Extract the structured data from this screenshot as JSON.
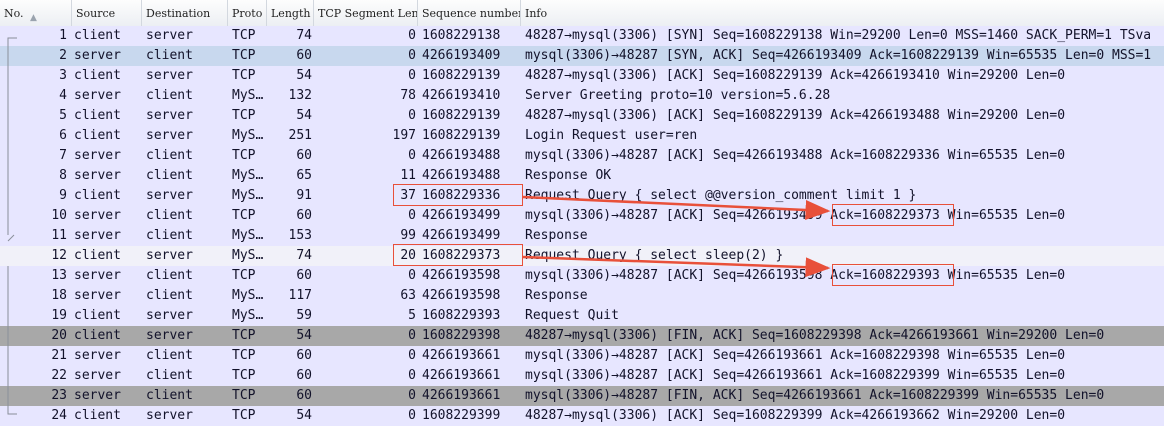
{
  "columns": {
    "no": "No.",
    "source": "Source",
    "destination": "Destination",
    "proto": "Proto",
    "length": "Length",
    "tcp_segment_len": "TCP Segment Len",
    "sequence_number": "Sequence number",
    "info": "Info"
  },
  "rows": [
    {
      "no": "1",
      "src": "client",
      "dst": "server",
      "proto": "TCP",
      "len": "74",
      "seglen": "0",
      "seq": "1608229138",
      "info": "48287→mysql(3306) [SYN] Seq=1608229138 Win=29200 Len=0 MSS=1460 SACK_PERM=1 TSva",
      "style": "normal"
    },
    {
      "no": "2",
      "src": "server",
      "dst": "client",
      "proto": "TCP",
      "len": "60",
      "seglen": "0",
      "seq": "4266193409",
      "info": "mysql(3306)→48287 [SYN, ACK] Seq=4266193409 Ack=1608229139 Win=65535 Len=0 MSS=1",
      "style": "selected"
    },
    {
      "no": "3",
      "src": "client",
      "dst": "server",
      "proto": "TCP",
      "len": "54",
      "seglen": "0",
      "seq": "1608229139",
      "info": "48287→mysql(3306) [ACK] Seq=1608229139 Ack=4266193410 Win=29200 Len=0",
      "style": "normal"
    },
    {
      "no": "4",
      "src": "server",
      "dst": "client",
      "proto": "MyS…",
      "len": "132",
      "seglen": "78",
      "seq": "4266193410",
      "info": "Server Greeting proto=10 version=5.6.28",
      "style": "normal"
    },
    {
      "no": "5",
      "src": "client",
      "dst": "server",
      "proto": "TCP",
      "len": "54",
      "seglen": "0",
      "seq": "1608229139",
      "info": "48287→mysql(3306) [ACK] Seq=1608229139 Ack=4266193488 Win=29200 Len=0",
      "style": "normal"
    },
    {
      "no": "6",
      "src": "client",
      "dst": "server",
      "proto": "MyS…",
      "len": "251",
      "seglen": "197",
      "seq": "1608229139",
      "info": "Login Request user=ren",
      "style": "normal"
    },
    {
      "no": "7",
      "src": "server",
      "dst": "client",
      "proto": "TCP",
      "len": "60",
      "seglen": "0",
      "seq": "4266193488",
      "info": "mysql(3306)→48287 [ACK] Seq=4266193488 Ack=1608229336 Win=65535 Len=0",
      "style": "normal"
    },
    {
      "no": "8",
      "src": "server",
      "dst": "client",
      "proto": "MyS…",
      "len": "65",
      "seglen": "11",
      "seq": "4266193488",
      "info": "Response OK",
      "style": "normal"
    },
    {
      "no": "9",
      "src": "client",
      "dst": "server",
      "proto": "MyS…",
      "len": "91",
      "seglen": "37",
      "seq": "1608229336",
      "info": "Request Query { select @@version_comment limit 1 }",
      "style": "normal"
    },
    {
      "no": "10",
      "src": "server",
      "dst": "client",
      "proto": "TCP",
      "len": "60",
      "seglen": "0",
      "seq": "4266193499",
      "info": "mysql(3306)→48287 [ACK] Seq=4266193499 Ack=1608229373 Win=65535 Len=0",
      "style": "normal"
    },
    {
      "no": "11",
      "src": "server",
      "dst": "client",
      "proto": "MyS…",
      "len": "153",
      "seglen": "99",
      "seq": "4266193499",
      "info": "Response",
      "style": "normal"
    },
    {
      "no": "12",
      "src": "client",
      "dst": "server",
      "proto": "MyS…",
      "len": "74",
      "seglen": "20",
      "seq": "1608229373",
      "info": "Request Query { select sleep(2) }",
      "style": "highlight"
    },
    {
      "no": "13",
      "src": "server",
      "dst": "client",
      "proto": "TCP",
      "len": "60",
      "seglen": "0",
      "seq": "4266193598",
      "info": "mysql(3306)→48287 [ACK] Seq=4266193598 Ack=1608229393 Win=65535 Len=0",
      "style": "normal"
    },
    {
      "no": "18",
      "src": "server",
      "dst": "client",
      "proto": "MyS…",
      "len": "117",
      "seglen": "63",
      "seq": "4266193598",
      "info": "Response",
      "style": "normal"
    },
    {
      "no": "19",
      "src": "client",
      "dst": "server",
      "proto": "MyS…",
      "len": "59",
      "seglen": "5",
      "seq": "1608229393",
      "info": "Request Quit",
      "style": "normal"
    },
    {
      "no": "20",
      "src": "client",
      "dst": "server",
      "proto": "TCP",
      "len": "54",
      "seglen": "0",
      "seq": "1608229398",
      "info": "48287→mysql(3306) [FIN, ACK] Seq=1608229398 Ack=4266193661 Win=29200 Len=0",
      "style": "dark"
    },
    {
      "no": "21",
      "src": "server",
      "dst": "client",
      "proto": "TCP",
      "len": "60",
      "seglen": "0",
      "seq": "4266193661",
      "info": "mysql(3306)→48287 [ACK] Seq=4266193661 Ack=1608229398 Win=65535 Len=0",
      "style": "normal"
    },
    {
      "no": "22",
      "src": "server",
      "dst": "client",
      "proto": "TCP",
      "len": "60",
      "seglen": "0",
      "seq": "4266193661",
      "info": "mysql(3306)→48287 [ACK] Seq=4266193661 Ack=1608229399 Win=65535 Len=0",
      "style": "normal"
    },
    {
      "no": "23",
      "src": "server",
      "dst": "client",
      "proto": "TCP",
      "len": "60",
      "seglen": "0",
      "seq": "4266193661",
      "info": "mysql(3306)→48287 [FIN, ACK] Seq=4266193661 Ack=1608229399 Win=65535 Len=0",
      "style": "dark"
    },
    {
      "no": "24",
      "src": "client",
      "dst": "server",
      "proto": "TCP",
      "len": "54",
      "seglen": "0",
      "seq": "1608229399",
      "info": "48287→mysql(3306) [ACK] Seq=1608229399 Ack=4266193662 Win=29200 Len=0",
      "style": "normal"
    }
  ],
  "colors": {
    "row_bg": "#e7e6ff",
    "row_selected": "#c8d8ee",
    "row_highlight": "#f1f1f9",
    "row_dark": "#a8a8a8",
    "annotation": "#e8503a"
  }
}
